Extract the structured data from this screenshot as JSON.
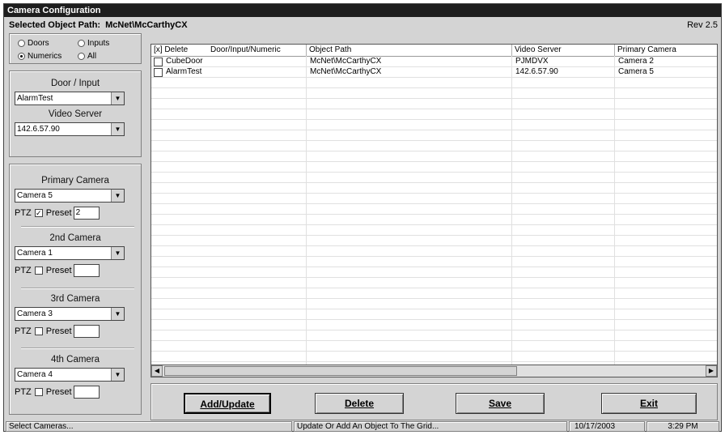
{
  "window": {
    "title": "Camera Configuration",
    "path_label": "Selected Object Path:",
    "path_value": "McNet\\McCarthyCX",
    "rev": "Rev 2.5"
  },
  "filters": {
    "doors": "Doors",
    "inputs": "Inputs",
    "numerics": "Numerics",
    "all": "All",
    "selected": "numerics"
  },
  "door_input": {
    "label": "Door / Input",
    "value": "AlarmTest"
  },
  "video_server": {
    "label": "Video Server",
    "value": "142.6.57.90"
  },
  "cameras": [
    {
      "label": "Primary Camera",
      "value": "Camera 5",
      "ptz": true,
      "preset": "2"
    },
    {
      "label": "2nd Camera",
      "value": "Camera 1",
      "ptz": false,
      "preset": ""
    },
    {
      "label": "3rd Camera",
      "value": "Camera 3",
      "ptz": false,
      "preset": ""
    },
    {
      "label": "4th Camera",
      "value": "Camera 4",
      "ptz": false,
      "preset": ""
    }
  ],
  "ptz_label": "PTZ",
  "preset_label": "Preset",
  "grid": {
    "headers": [
      "[x] Delete",
      "Door/Input/Numeric",
      "Object Path",
      "Video Server",
      "Primary Camera"
    ],
    "rows": [
      {
        "name": "CubeDoor",
        "path": "McNet\\McCarthyCX",
        "server": "PJMDVX",
        "camera": "Camera 2"
      },
      {
        "name": "AlarmTest",
        "path": "McNet\\McCarthyCX",
        "server": "142.6.57.90",
        "camera": "Camera 5"
      }
    ]
  },
  "buttons": {
    "add": "Add/Update",
    "delete": "Delete",
    "save": "Save",
    "exit": "Exit"
  },
  "status": {
    "left": "Select Cameras...",
    "middle": "Update Or Add An Object To The Grid...",
    "date": "10/17/2003",
    "time": "3:29 PM"
  }
}
